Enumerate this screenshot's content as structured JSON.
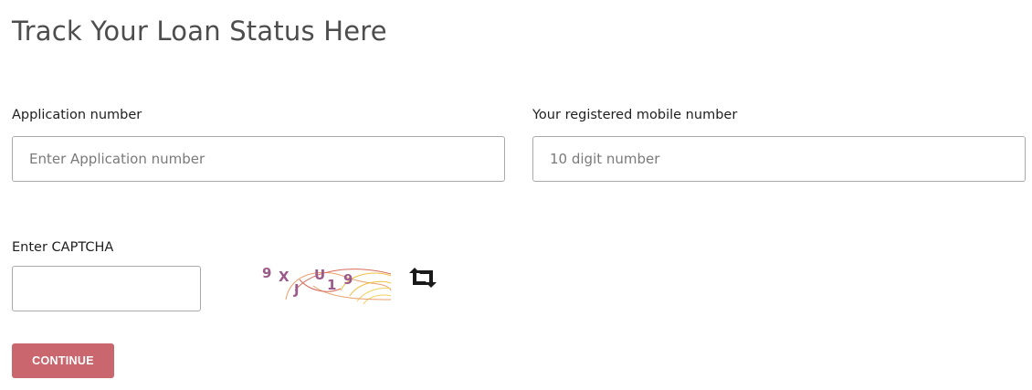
{
  "page": {
    "title": "Track Your Loan Status Here"
  },
  "form": {
    "application_label": "Application number",
    "application_placeholder": "Enter Application number",
    "application_value": "",
    "mobile_label": "Your registered mobile number",
    "mobile_placeholder": "10 digit number",
    "mobile_value": "",
    "captcha_label": "Enter CAPTCHA",
    "captcha_value": "",
    "captcha_text": "9XJU19",
    "continue_label": "CONTINUE"
  },
  "icons": {
    "refresh": "refresh-icon"
  },
  "colors": {
    "button_bg": "#c9666e",
    "title": "#4d4d4d",
    "input_border": "#a9a9a9"
  }
}
